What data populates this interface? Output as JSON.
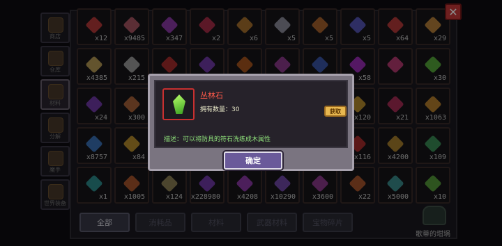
{
  "sidebar": {
    "tabs": [
      {
        "label": "商店",
        "active": false
      },
      {
        "label": "仓库",
        "active": false
      },
      {
        "label": "材料",
        "active": true
      },
      {
        "label": "分解",
        "active": false
      },
      {
        "label": "魔手",
        "active": false
      },
      {
        "label": "世界装备",
        "active": false
      }
    ]
  },
  "grid": {
    "items": [
      {
        "count": "x12",
        "color": "#d04040"
      },
      {
        "count": "x9485",
        "color": "#c06070"
      },
      {
        "count": "x347",
        "color": "#a040c0"
      },
      {
        "count": "x2",
        "color": "#c03050"
      },
      {
        "count": "x6",
        "color": "#c08030"
      },
      {
        "count": "x5",
        "color": "#a0a0b0"
      },
      {
        "count": "x5",
        "color": "#c07030"
      },
      {
        "count": "x5",
        "color": "#6060d0"
      },
      {
        "count": "x64",
        "color": "#d04040"
      },
      {
        "count": "x29",
        "color": "#d09040"
      },
      {
        "count": "x4385",
        "color": "#d0b060"
      },
      {
        "count": "x215",
        "color": "#b0b0b0"
      },
      {
        "count": "",
        "color": "#c03030"
      },
      {
        "count": "",
        "color": "#8040c0"
      },
      {
        "count": "",
        "color": "#c06020"
      },
      {
        "count": "",
        "color": "#a040a0"
      },
      {
        "count": "",
        "color": "#4060c0"
      },
      {
        "count": "x58",
        "color": "#b030d0"
      },
      {
        "count": "",
        "color": "#d04080"
      },
      {
        "count": "x30",
        "color": "#60c040"
      },
      {
        "count": "x24",
        "color": "#8040c0"
      },
      {
        "count": "x300",
        "color": "#c07040"
      },
      {
        "count": "",
        "color": "#000000"
      },
      {
        "count": "",
        "color": "#000000"
      },
      {
        "count": "",
        "color": "#000000"
      },
      {
        "count": "",
        "color": "#000000"
      },
      {
        "count": "",
        "color": "#000000"
      },
      {
        "count": "x120",
        "color": "#d0a030"
      },
      {
        "count": "x21",
        "color": "#c03060"
      },
      {
        "count": "x1063",
        "color": "#d09030"
      },
      {
        "count": "x8757",
        "color": "#4080d0"
      },
      {
        "count": "x84",
        "color": "#d0a030"
      },
      {
        "count": "",
        "color": "#000000"
      },
      {
        "count": "",
        "color": "#000000"
      },
      {
        "count": "",
        "color": "#000000"
      },
      {
        "count": "",
        "color": "#000000"
      },
      {
        "count": "",
        "color": "#000000"
      },
      {
        "count": "x116",
        "color": "#c03030"
      },
      {
        "count": "x4200",
        "color": "#c09030"
      },
      {
        "count": "x109",
        "color": "#40a060"
      },
      {
        "count": "x1",
        "color": "#30a0a0"
      },
      {
        "count": "x1005",
        "color": "#c06030"
      },
      {
        "count": "x124",
        "color": "#a09060"
      },
      {
        "count": "x228980",
        "color": "#8040c0"
      },
      {
        "count": "x4208",
        "color": "#a040c0"
      },
      {
        "count": "x10290",
        "color": "#8050c0"
      },
      {
        "count": "x3600",
        "color": "#a040a0"
      },
      {
        "count": "x22",
        "color": "#c06030"
      },
      {
        "count": "x5000",
        "color": "#40a0a0"
      },
      {
        "count": "x10",
        "color": "#60b040"
      }
    ]
  },
  "bottom_tabs": [
    {
      "label": "全部",
      "active": true
    },
    {
      "label": "消耗品",
      "active": false
    },
    {
      "label": "材料",
      "active": false
    },
    {
      "label": "武器材料",
      "active": false
    },
    {
      "label": "宝物碎片",
      "active": false
    }
  ],
  "forge": {
    "label": "歌蒂的坩埚"
  },
  "close_icon": "close-icon",
  "modal": {
    "item_name": "丛林石",
    "owned_count": "拥有数量：30",
    "get_label": "获取",
    "description": "描述：可以将防具的符石洗练成木属性",
    "confirm_label": "确定"
  }
}
